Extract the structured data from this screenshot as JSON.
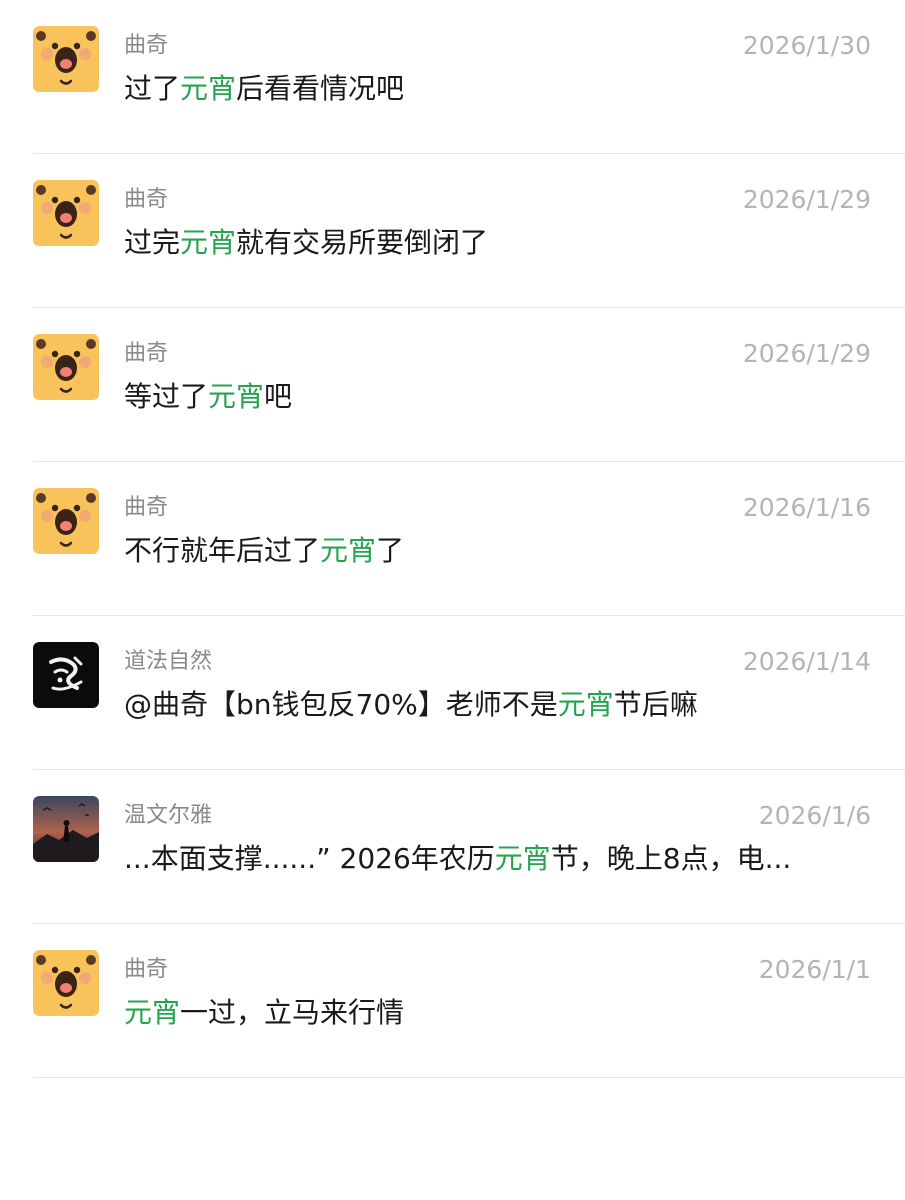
{
  "colors": {
    "highlight": "#27a350",
    "sender": "#8a8a8a",
    "date": "#b4b4b4",
    "text": "#1a1a1a"
  },
  "results": [
    {
      "avatar": "bear-avatar",
      "sender": "曲奇",
      "date": "2026/1/30",
      "message": {
        "before": "过了",
        "highlight": "元宵",
        "after": "后看看情况吧"
      }
    },
    {
      "avatar": "bear-avatar",
      "sender": "曲奇",
      "date": "2026/1/29",
      "message": {
        "before": "过完",
        "highlight": "元宵",
        "after": "就有交易所要倒闭了"
      }
    },
    {
      "avatar": "bear-avatar",
      "sender": "曲奇",
      "date": "2026/1/29",
      "message": {
        "before": "等过了",
        "highlight": "元宵",
        "after": "吧"
      }
    },
    {
      "avatar": "bear-avatar",
      "sender": "曲奇",
      "date": "2026/1/16",
      "message": {
        "before": "不行就年后过了",
        "highlight": "元宵",
        "after": "了"
      }
    },
    {
      "avatar": "calligraphy-avatar",
      "sender": "道法自然",
      "date": "2026/1/14",
      "message": {
        "before": "@曲奇【bn钱包反70%】老师不是",
        "highlight": "元宵",
        "after": "节后嘛"
      }
    },
    {
      "avatar": "landscape-avatar",
      "sender": "温文尔雅",
      "date": "2026/1/6",
      "message": {
        "before": "...本面支撑......” 2026年农历",
        "highlight": "元宵",
        "after": "节，晚上8点，电..."
      }
    },
    {
      "avatar": "bear-avatar",
      "sender": "曲奇",
      "date": "2026/1/1",
      "message": {
        "before": "",
        "highlight": "元宵",
        "after": "一过，立马来行情"
      }
    }
  ]
}
